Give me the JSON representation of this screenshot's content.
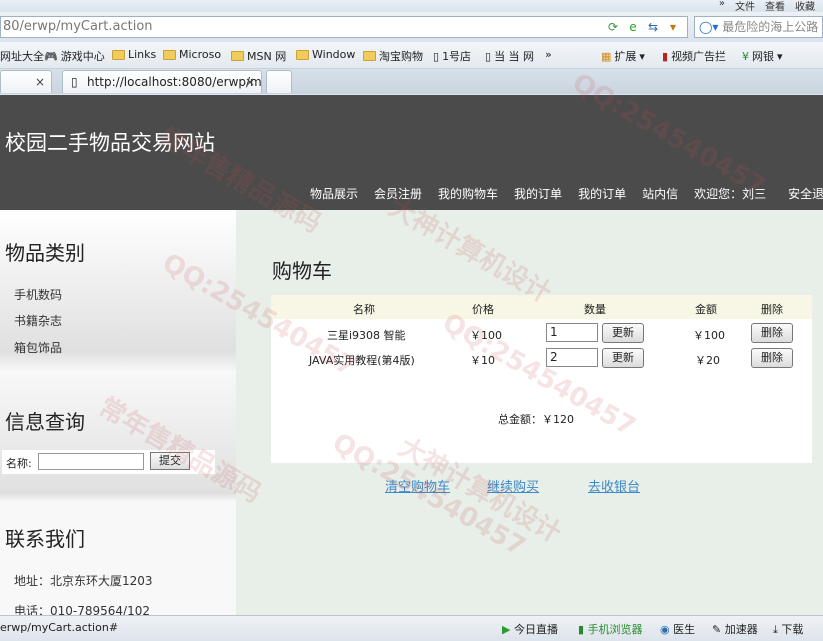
{
  "browser": {
    "menu": [
      "»",
      "文件",
      "查看",
      "收藏"
    ],
    "url": "80/erwp/myCart.action",
    "search_placeholder": "最危险的海上公路",
    "favorites": [
      "网址大全",
      "游戏中心",
      "Links",
      "Microso",
      "MSN 网",
      "Window",
      "淘宝购物",
      "1号店",
      "当 当 网",
      "»",
      "扩展",
      "视频广告拦",
      "网银"
    ],
    "tabs": [
      {
        "label": ""
      },
      {
        "label": "http://localhost:8080/erwp/m"
      }
    ],
    "tab_close": "×",
    "status_url": "erwp/myCart.action#",
    "status_items": [
      "今日直播",
      "手机浏览器",
      "医生",
      "加速器",
      "下载"
    ]
  },
  "site": {
    "title": "校园二手物品交易网站",
    "nav": [
      "物品展示",
      "会员注册",
      "我的购物车",
      "我的订单",
      "我的订单",
      "站内信",
      "欢迎您：刘三",
      "安全退出"
    ]
  },
  "sidebar": {
    "categories_title": "物品类别",
    "categories": [
      "手机数码",
      "书籍杂志",
      "箱包饰品"
    ],
    "query_title": "信息查询",
    "query_label": "名称:",
    "query_button": "提交",
    "contact_title": "联系我们",
    "address": "地址：北京东环大厦1203",
    "phone": "电话：010-789564/102"
  },
  "cart": {
    "title": "购物车",
    "columns": [
      "名称",
      "价格",
      "数量",
      "金额",
      "删除"
    ],
    "rows": [
      {
        "name": "三星i9308 智能",
        "price": "￥100",
        "qty": "1",
        "update": "更新",
        "amount": "￥100",
        "delete": "删除"
      },
      {
        "name": "JAVA实用教程(第4版)",
        "price": "￥10",
        "qty": "2",
        "update": "更新",
        "amount": "￥20",
        "delete": "删除"
      }
    ],
    "total": "总金额：￥120",
    "actions": [
      "清空购物车",
      "继续购买",
      "去收银台"
    ]
  },
  "watermarks": [
    "QQ:254540457",
    "大神计算机设计",
    "常年售精品源码"
  ]
}
